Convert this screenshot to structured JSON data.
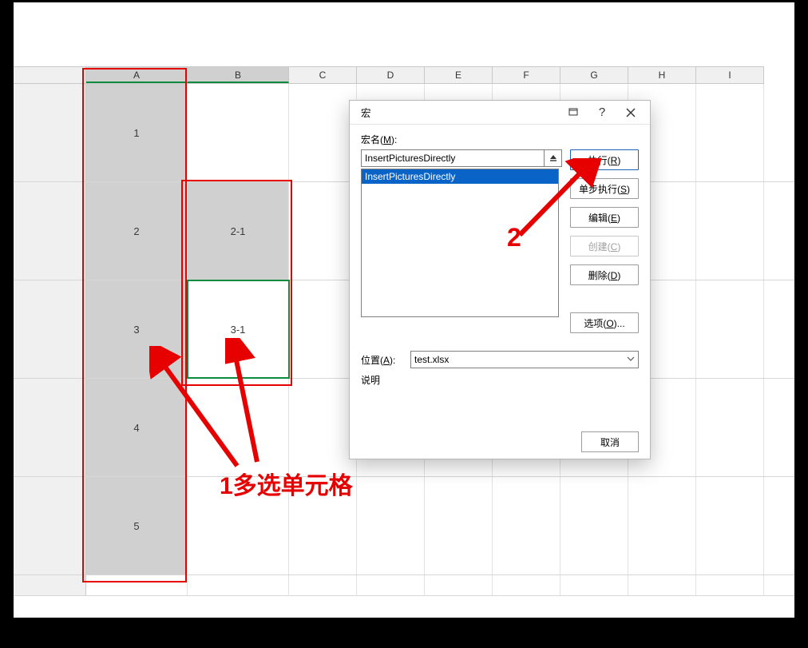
{
  "columns": [
    "A",
    "B",
    "C",
    "D",
    "E",
    "F",
    "G",
    "H",
    "I"
  ],
  "cells": {
    "A1": "1",
    "A2": "2",
    "A3": "3",
    "A4": "4",
    "A5": "5",
    "B2": "2-1",
    "B3": "3-1"
  },
  "dialog": {
    "title": "宏",
    "name_label_prefix": "宏名(",
    "name_label_key": "M",
    "name_label_suffix": "):",
    "input_value": "InsertPicturesDirectly",
    "list": [
      "InsertPicturesDirectly"
    ],
    "buttons": {
      "run": "执行(R)",
      "step": "单步执行(S)",
      "edit": "编辑(E)",
      "create": "创建(C)",
      "delete": "删除(D)",
      "options": "选项(O)..."
    },
    "location_label_prefix": "位置(",
    "location_label_key": "A",
    "location_label_suffix": "):",
    "location_value": "test.xlsx",
    "desc_label": "说明",
    "cancel": "取消"
  },
  "annotations": {
    "step1": "1多选单元格",
    "step2": "2"
  }
}
